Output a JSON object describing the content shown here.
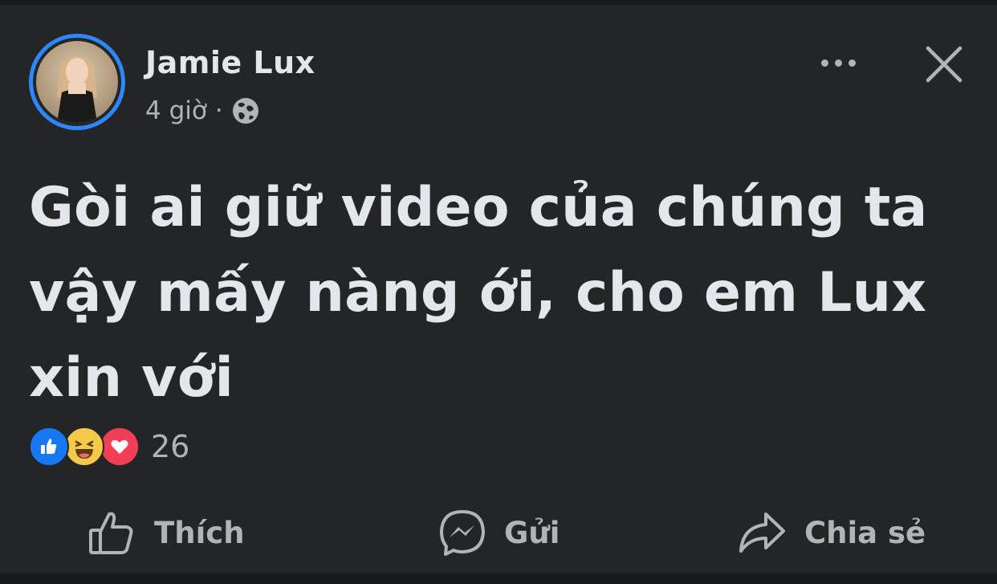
{
  "post": {
    "author": "Jamie Lux",
    "time": "4 giờ",
    "separator": "·",
    "audience_icon": "globe-icon",
    "text": "Gòi ai giữ video của chúng ta vậy mấy nàng ới, cho em Lux xin với",
    "reactions": {
      "types": [
        "like",
        "haha",
        "love"
      ],
      "count": "26"
    }
  },
  "actions": {
    "like_label": "Thích",
    "send_label": "Gửi",
    "share_label": "Chia sẻ"
  },
  "colors": {
    "background": "#242526",
    "text_primary": "#e4e6eb",
    "text_secondary": "#b0b3b8",
    "story_ring": "#2d88ff",
    "like": "#1877f2",
    "haha": "#f7c948",
    "love": "#f33e58"
  }
}
